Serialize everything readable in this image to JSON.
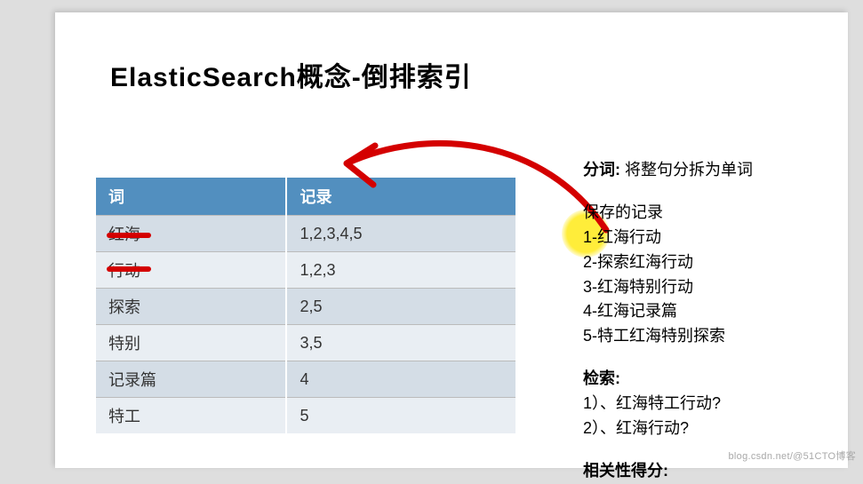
{
  "title": "ElasticSearch概念-倒排索引",
  "table": {
    "headers": [
      "词",
      "记录"
    ],
    "rows": [
      {
        "term": "红海",
        "records": "1,2,3,4,5"
      },
      {
        "term": "行动",
        "records": "1,2,3"
      },
      {
        "term": "探索",
        "records": "2,5"
      },
      {
        "term": "特别",
        "records": "3,5"
      },
      {
        "term": "记录篇",
        "records": "4"
      },
      {
        "term": "特工",
        "records": "5"
      }
    ]
  },
  "right": {
    "tokenize_label": "分词:",
    "tokenize_text": "将整句分拆为单词",
    "saved_label": "保存的记录",
    "saved_items": [
      "1-红海行动",
      "2-探索红海行动",
      "3-红海特别行动",
      "4-红海记录篇",
      "5-特工红海特别探索"
    ],
    "search_label": "检索:",
    "search_items": [
      "1）、红海特工行动?",
      "2）、红海行动?"
    ],
    "relevance_label": "相关性得分:"
  },
  "watermark": "blog.csdn.net/@51CTO博客"
}
